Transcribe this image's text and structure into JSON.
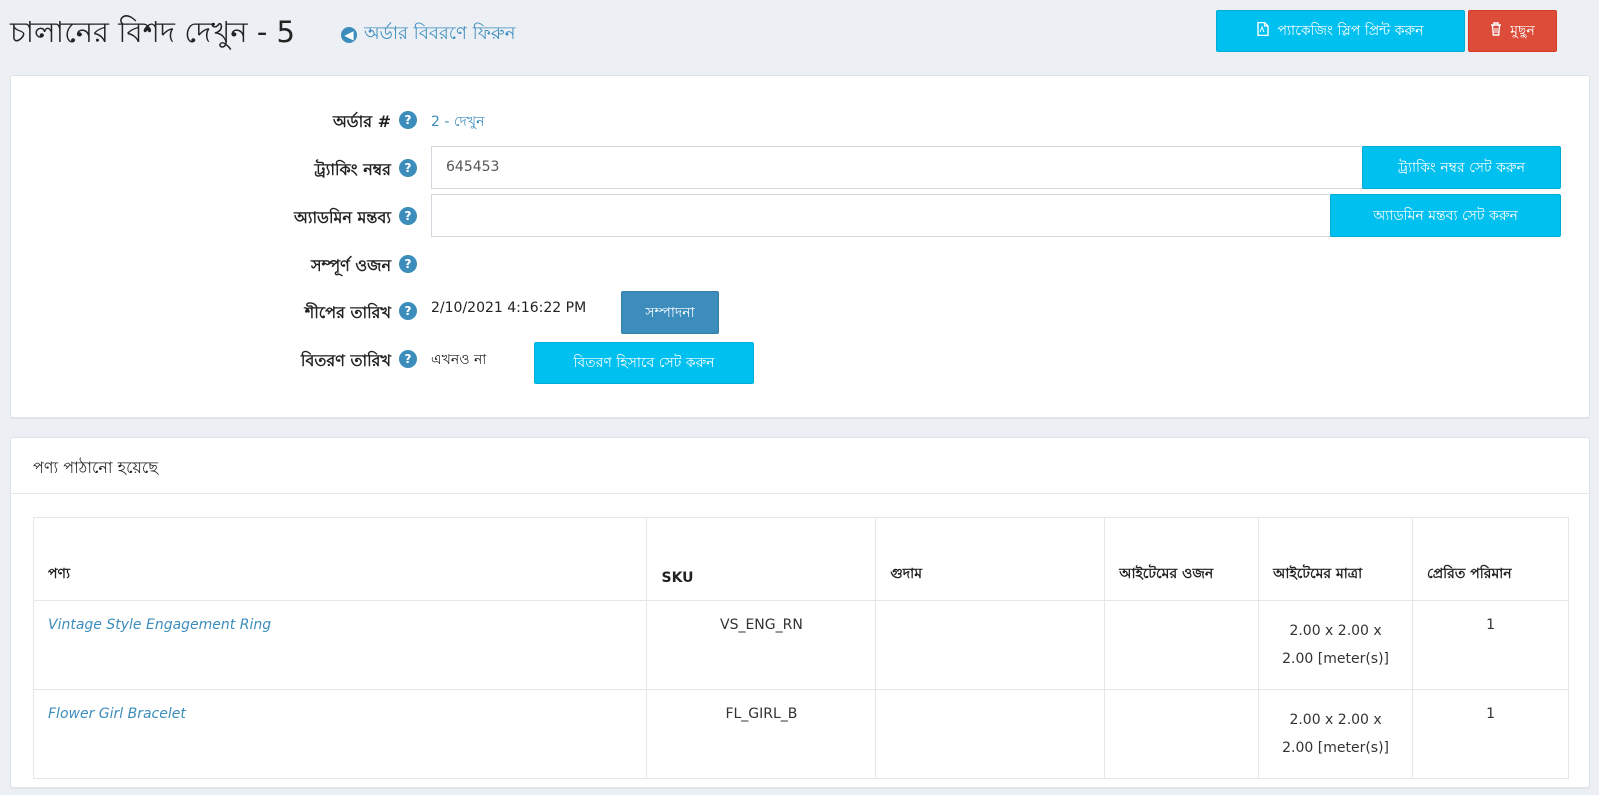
{
  "header": {
    "title": "চালানের বিশদ দেখুন - 5",
    "back_link": "অর্ডার বিবরণে ফিরুন",
    "print_button": "প্যাকেজিং স্লিপ প্রিন্ট করুন",
    "delete_button": "মুছুন"
  },
  "info": {
    "order_label": "অর্ডার #",
    "order_value": "2 - দেখুন",
    "tracking_label": "ট্র্যাকিং নম্বর",
    "tracking_value": "645453",
    "tracking_button": "ট্র্যাকিং নম্বর সেট করুন",
    "admin_comment_label": "অ্যাডমিন মন্তব্য",
    "admin_comment_value": "",
    "admin_comment_button": "অ্যাডমিন মন্তব্য সেট করুন",
    "total_weight_label": "সম্পূর্ণ ওজন",
    "shipped_date_label": "শীপের তারিখ",
    "shipped_date_value": "2/10/2021 4:16:22 PM",
    "edit_button": "সম্পাদনা",
    "delivery_date_label": "বিতরণ তারিখ",
    "delivery_date_value": "এখনও না",
    "set_delivered_button": "বিতরণ হিসাবে সেট করুন",
    "help_glyph": "?"
  },
  "products": {
    "title": "পণ্য পাঠানো হয়েছে",
    "columns": [
      "পণ্য",
      "SKU",
      "গুদাম",
      "আইটেমের ওজন",
      "আইটেমের মাত্রা",
      "প্রেরিত পরিমান"
    ],
    "rows": [
      {
        "name": "Vintage Style Engagement Ring",
        "sku": "VS_ENG_RN",
        "warehouse": "",
        "weight": "",
        "dims_line1": "2.00 x 2.00 x",
        "dims_line2": "2.00 [meter(s)]",
        "qty": "1"
      },
      {
        "name": "Flower Girl Bracelet",
        "sku": "FL_GIRL_B",
        "warehouse": "",
        "weight": "",
        "dims_line1": "2.00 x 2.00 x",
        "dims_line2": "2.00 [meter(s)]",
        "qty": "1"
      }
    ]
  },
  "colors": {
    "accent": "#3c8dbc",
    "info": "#00c0ef",
    "danger": "#dd4b39",
    "background": "#ecf0f5"
  },
  "icons": {
    "back": "arrow-circle-left-icon",
    "print": "file-pdf-icon",
    "delete": "trash-icon",
    "help": "question-circle-icon"
  }
}
